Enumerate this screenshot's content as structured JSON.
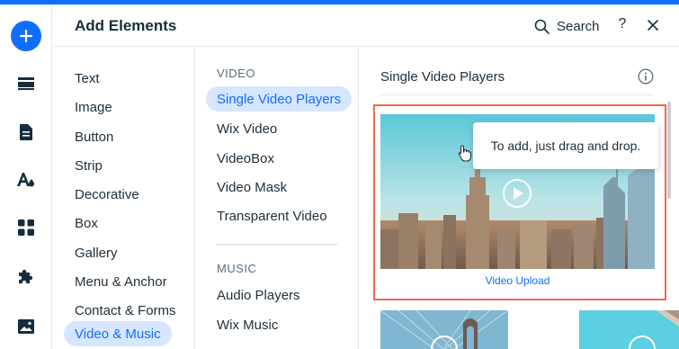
{
  "panel": {
    "title": "Add Elements",
    "search_label": "Search",
    "help_label": "?"
  },
  "rail": {
    "items": [
      "add-icon",
      "sections-icon",
      "pages-icon",
      "design-icon",
      "apps-icon",
      "business-icon",
      "media-icon"
    ]
  },
  "categories": [
    {
      "label": "Text"
    },
    {
      "label": "Image"
    },
    {
      "label": "Button"
    },
    {
      "label": "Strip"
    },
    {
      "label": "Decorative"
    },
    {
      "label": "Box"
    },
    {
      "label": "Gallery"
    },
    {
      "label": "Menu & Anchor"
    },
    {
      "label": "Contact & Forms"
    },
    {
      "label": "Video & Music",
      "active": true
    }
  ],
  "subcategories": {
    "video_title": "VIDEO",
    "video_items": [
      {
        "label": "Single Video Players",
        "active": true
      },
      {
        "label": "Wix Video"
      },
      {
        "label": "VideoBox"
      },
      {
        "label": "Video Mask"
      },
      {
        "label": "Transparent Video"
      }
    ],
    "music_title": "MUSIC",
    "music_items": [
      {
        "label": "Audio Players"
      },
      {
        "label": "Wix Music"
      }
    ]
  },
  "content": {
    "title": "Single Video Players",
    "card_caption": "Video Upload",
    "tooltip": "To add, just drag and drop."
  },
  "colors": {
    "accent": "#116dff",
    "active_bg": "#d6e6fe",
    "highlight_outline": "#f0694d"
  }
}
